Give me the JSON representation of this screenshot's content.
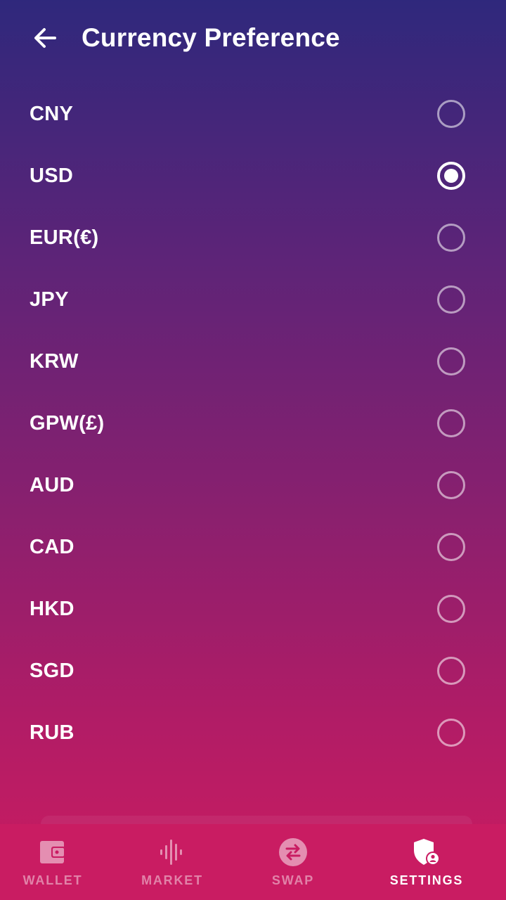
{
  "header": {
    "title": "Currency Preference",
    "back_icon": "arrow-left-icon"
  },
  "currencies": [
    {
      "label": "CNY",
      "selected": false
    },
    {
      "label": "USD",
      "selected": true
    },
    {
      "label": "EUR(€)",
      "selected": false
    },
    {
      "label": "JPY",
      "selected": false
    },
    {
      "label": "KRW",
      "selected": false
    },
    {
      "label": "GPW(£)",
      "selected": false
    },
    {
      "label": "AUD",
      "selected": false
    },
    {
      "label": "CAD",
      "selected": false
    },
    {
      "label": "HKD",
      "selected": false
    },
    {
      "label": "SGD",
      "selected": false
    },
    {
      "label": "RUB",
      "selected": false
    }
  ],
  "bottom_nav": {
    "items": [
      {
        "label": "WALLET",
        "icon": "wallet-icon",
        "active": false
      },
      {
        "label": "MARKET",
        "icon": "waveform-icon",
        "active": false
      },
      {
        "label": "SWAP",
        "icon": "swap-icon",
        "active": false
      },
      {
        "label": "SETTINGS",
        "icon": "shield-user-icon",
        "active": true
      }
    ]
  },
  "colors": {
    "gradient_top": "#2f287c",
    "gradient_bottom": "#cc1b60",
    "nav_background": "#c91c62",
    "text": "#ffffff"
  }
}
